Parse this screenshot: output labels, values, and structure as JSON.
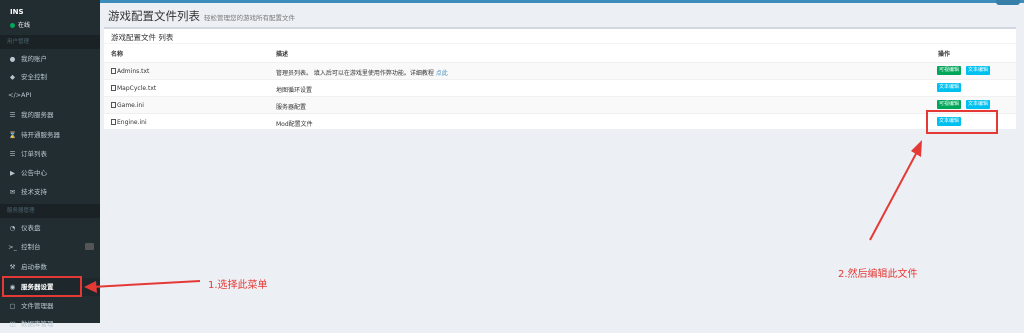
{
  "sidebar": {
    "brand": "INS",
    "status": "在线",
    "section1": "用户管理",
    "items1": [
      {
        "label": "我的账户",
        "icon": "lock-icon"
      },
      {
        "label": "安全控制",
        "icon": "shield-icon"
      },
      {
        "label": "API",
        "icon": "code-icon"
      },
      {
        "label": "我的服务器",
        "icon": "server-icon"
      },
      {
        "label": "待开通服务器",
        "icon": "hourglass-icon"
      },
      {
        "label": "订单列表",
        "icon": "list-icon"
      },
      {
        "label": "公告中心",
        "icon": "megaphone-icon"
      },
      {
        "label": "技术支持",
        "icon": "envelope-icon"
      }
    ],
    "section2": "服务器管理",
    "items2": [
      {
        "label": "仪表盘",
        "icon": "dashboard-icon"
      },
      {
        "label": "控制台",
        "icon": "terminal-icon"
      },
      {
        "label": "启动参数",
        "icon": "wrench-icon"
      },
      {
        "label": "服务器设置",
        "icon": "toggle-icon"
      },
      {
        "label": "文件管理器",
        "icon": "folder-icon"
      },
      {
        "label": "数据库管理",
        "icon": "database-icon"
      }
    ]
  },
  "header": {
    "title": "游戏配置文件列表",
    "subtitle": "轻松管理您的游戏所有配置文件"
  },
  "box": {
    "title": "游戏配置文件 列表",
    "columns": {
      "name": "名称",
      "desc": "描述",
      "action": "操作"
    },
    "rows": [
      {
        "name": "Admins.txt",
        "desc": "管理员列表。 填入后可以在游戏里使用作弊功能。详细教程",
        "link": "点此",
        "visual": true,
        "text": true
      },
      {
        "name": "MapCycle.txt",
        "desc": "地图循环设置",
        "link": "",
        "visual": false,
        "text": true
      },
      {
        "name": "Game.ini",
        "desc": "服务器配置",
        "link": "",
        "visual": true,
        "text": true
      },
      {
        "name": "Engine.ini",
        "desc": "Mod配置文件",
        "link": "",
        "visual": false,
        "text": true
      }
    ],
    "btn_visual": "可视编辑",
    "btn_text": "文本编辑"
  },
  "annotations": {
    "step1": "1.选择此菜单",
    "step2": "2.然后编辑此文件"
  },
  "colors": {
    "sidebar": "#222d32",
    "accent": "#3c8dbc",
    "annotation": "#e53935"
  }
}
